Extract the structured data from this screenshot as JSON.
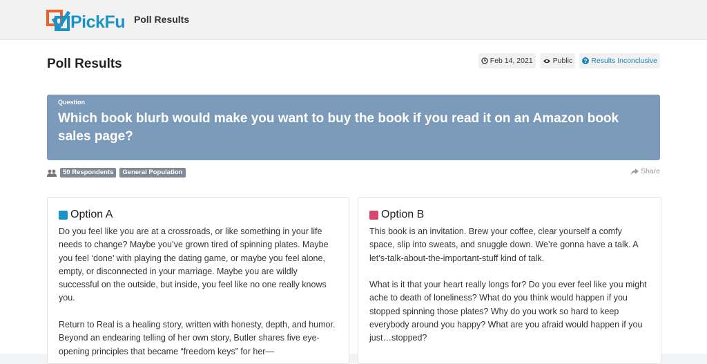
{
  "header": {
    "logo_text_pick": "Pick",
    "logo_text_fu": "Fu",
    "title": "Poll Results"
  },
  "page": {
    "title": "Poll Results",
    "date": "Feb 14, 2021",
    "visibility": "Public",
    "status": "Results Inconclusive"
  },
  "question": {
    "label": "Question",
    "text": "Which book blurb would make you want to buy the book if you read it on an Amazon book sales page?"
  },
  "meta": {
    "respondents": "50 Respondents",
    "audience": "General Population",
    "share_label": "Share"
  },
  "options": [
    {
      "label": "Option A",
      "color": "#1b93c9",
      "paragraphs": [
        "Do you feel like you are at a crossroads, or like something in your life needs to change? Maybe you’ve grown tired of spinning plates. Maybe you feel ‘done’ with playing the dating game, or maybe you feel alone, empty, or disconnected in your marriage. Maybe you are wildly successful on the outside, but inside, you feel like no one really knows you.",
        "Return to Real is a healing story, written with honesty, depth, and humor. Beyond an endearing telling of her own story, Butler shares five eye-opening principles that became “freedom keys” for her—"
      ]
    },
    {
      "label": "Option B",
      "color": "#d9466f",
      "paragraphs": [
        "This book is an invitation. Brew your coffee, clear yourself a comfy space, slip into sweats, and snuggle down. We’re gonna have a talk. A let’s-talk-about-the-important-stuff kind of talk.",
        "What is it that your heart really longs for? Do you ever feel like you might ache to death of loneliness? What do you think would happen if you stopped spinning those plates? Why do you work so hard to keep everybody around you happy? What are you afraid would happen if you just…stopped?"
      ]
    }
  ],
  "colors": {
    "brand_blue": "#1b93c9",
    "brand_orange": "#e8632b",
    "question_bg": "#7c9ab9",
    "tag_bg": "#7f8a96"
  },
  "icons": [
    "pickfu-logo-icon",
    "clock-icon",
    "eye-icon",
    "question-circle-icon",
    "users-icon",
    "share-icon"
  ]
}
